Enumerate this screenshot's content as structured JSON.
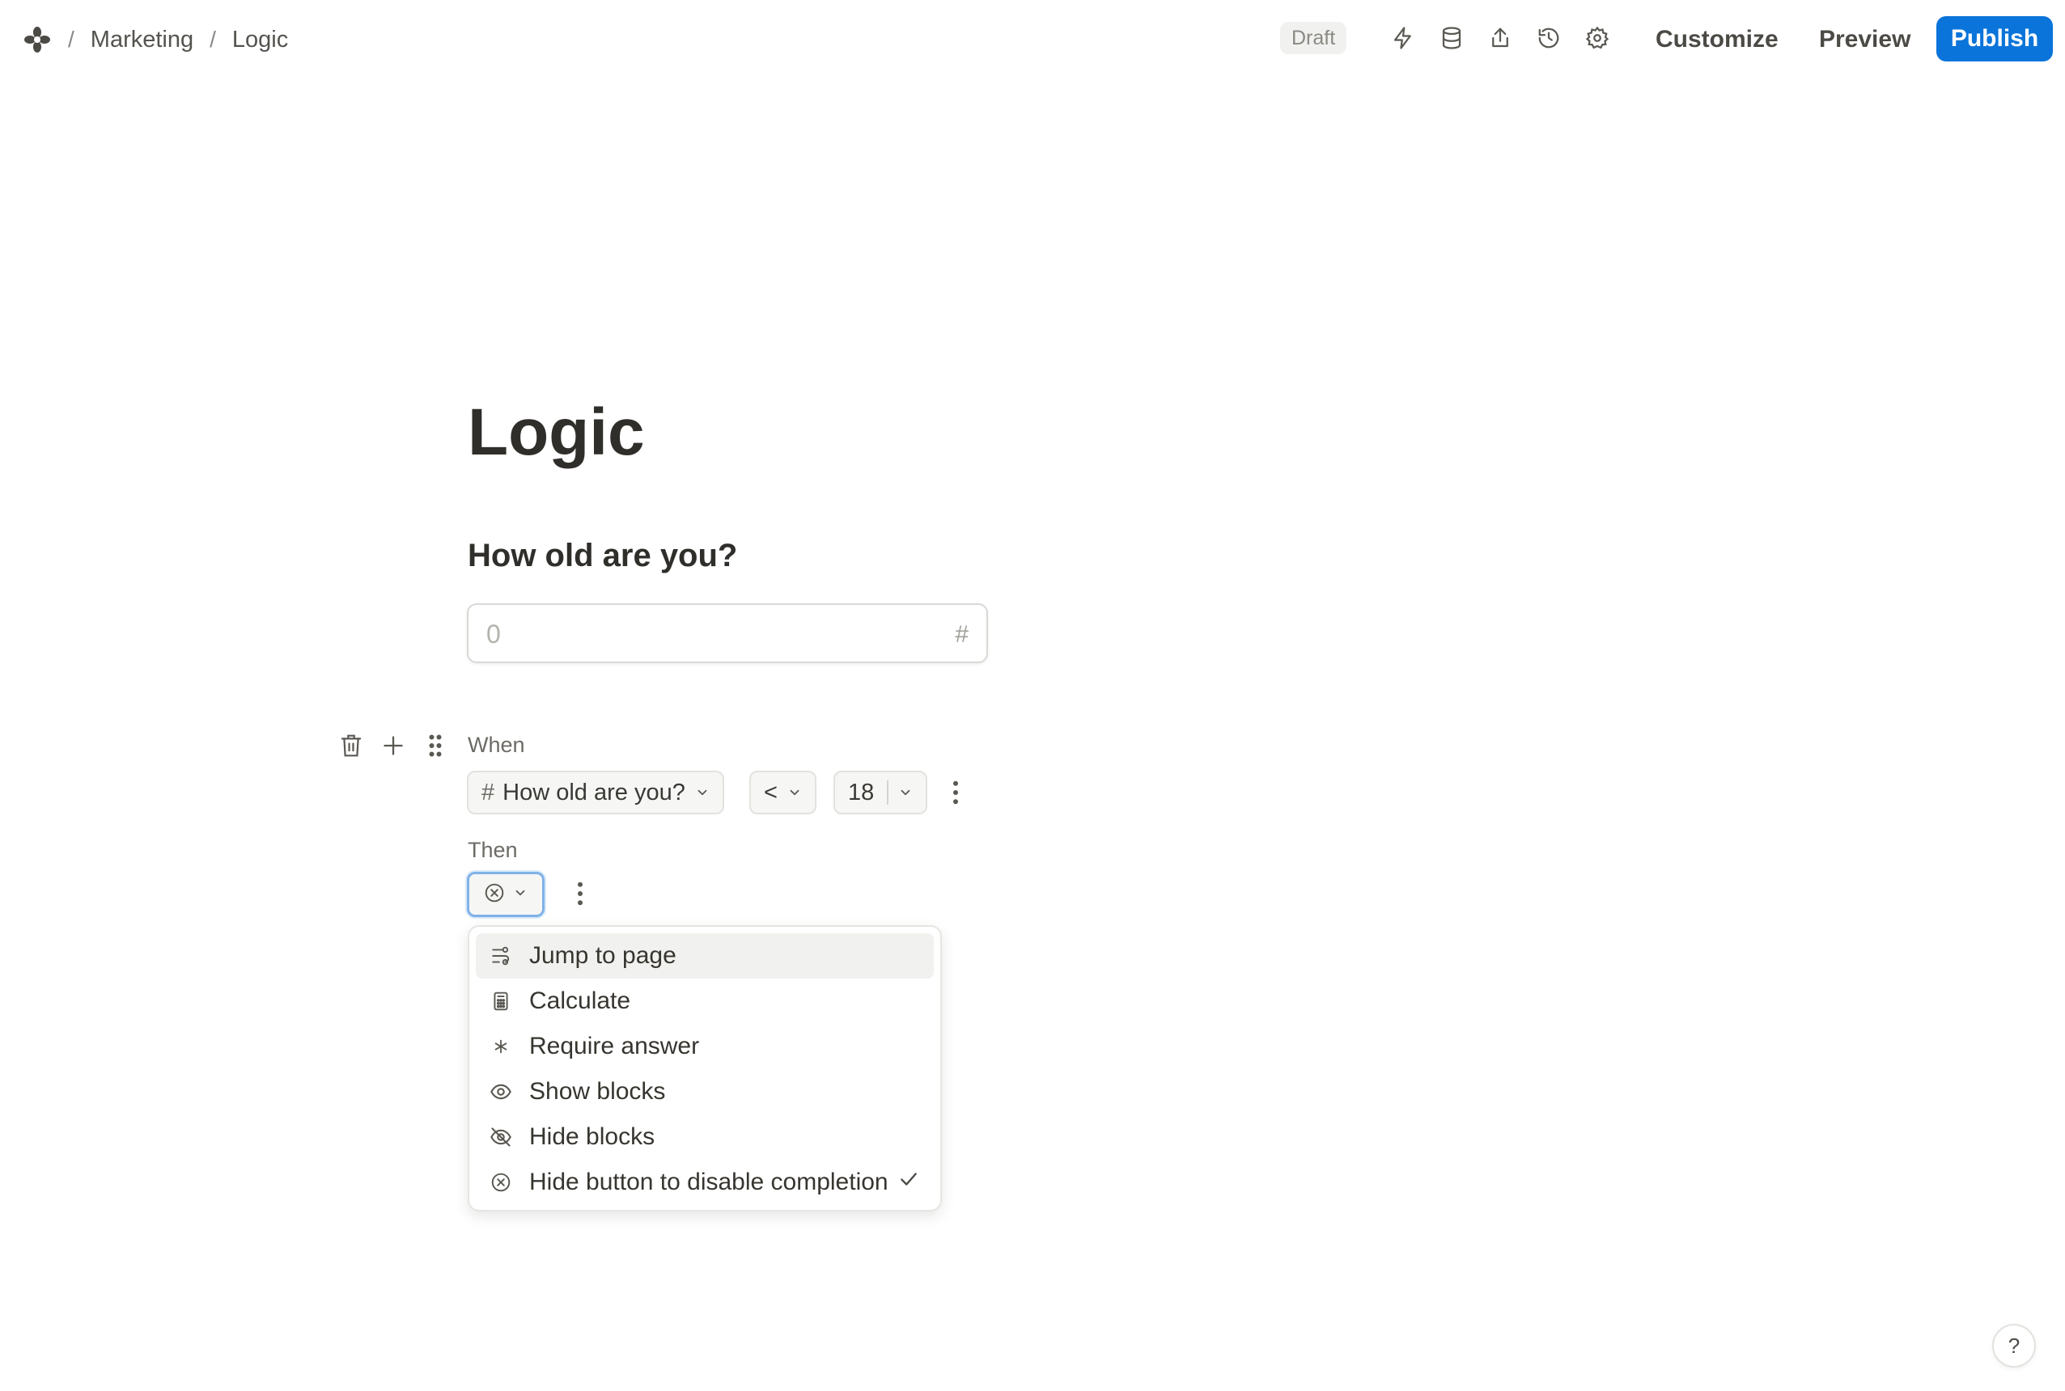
{
  "breadcrumb": {
    "logo_icon": "asterisk-logo-icon",
    "items": [
      "Marketing",
      "Logic"
    ],
    "separator": "/"
  },
  "toolbar": {
    "status_badge": "Draft",
    "icons": [
      "lightning-icon",
      "database-icon",
      "share-icon",
      "history-icon",
      "gear-icon"
    ],
    "customize_label": "Customize",
    "preview_label": "Preview",
    "publish_label": "Publish",
    "accent_color": "#0a74da"
  },
  "page": {
    "title": "Logic",
    "question": "How old are you?",
    "number_input": {
      "placeholder": "0",
      "value": "",
      "suffix_icon": "#"
    }
  },
  "logic_block": {
    "when_label": "When",
    "condition": {
      "field_label": "How old are you?",
      "field_icon": "#",
      "operator": "<",
      "value": "18"
    },
    "then_label": "Then",
    "action_selected_icon": "x-circle-icon"
  },
  "action_menu": {
    "items": [
      {
        "label": "Jump to page",
        "icon": "jump-icon",
        "highlighted": true,
        "selected": false
      },
      {
        "label": "Calculate",
        "icon": "calculator-icon",
        "highlighted": false,
        "selected": false
      },
      {
        "label": "Require answer",
        "icon": "asterisk-icon",
        "highlighted": false,
        "selected": false
      },
      {
        "label": "Show blocks",
        "icon": "eye-icon",
        "highlighted": false,
        "selected": false
      },
      {
        "label": "Hide blocks",
        "icon": "eye-off-icon",
        "highlighted": false,
        "selected": false
      },
      {
        "label": "Hide button to disable completion",
        "icon": "x-circle-icon",
        "highlighted": false,
        "selected": true
      }
    ]
  },
  "help": {
    "label": "?"
  }
}
